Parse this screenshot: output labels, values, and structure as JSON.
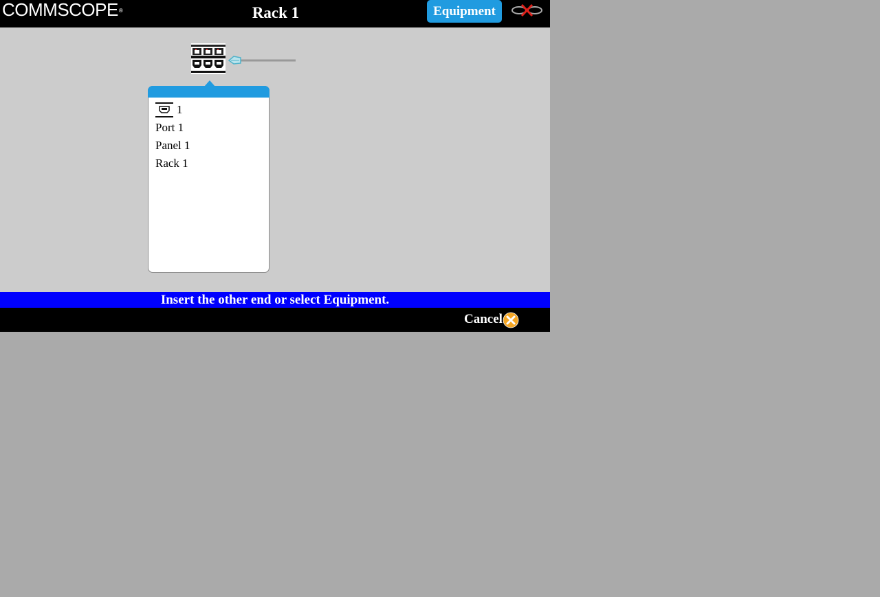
{
  "header": {
    "logo_text": "COMMSCOPE",
    "logo_mark": "®",
    "title": "Rack 1",
    "equipment_label": "Equipment",
    "disconnect_icon": "cable-disconnect-icon"
  },
  "canvas": {
    "panel_icon": "patch-panel-icon",
    "cable_icon": "patch-cord-icon"
  },
  "popup": {
    "port_icon": "rj45-port-icon",
    "port_number": "1",
    "lines": [
      "Port 1",
      "Panel 1",
      "Rack 1"
    ]
  },
  "status": {
    "message": "Insert the other end or select Equipment."
  },
  "footer": {
    "cancel_label": "Cancel",
    "cancel_icon": "cancel-x-icon"
  },
  "colors": {
    "accent_blue": "#209be0",
    "status_blue": "#0000ff",
    "cancel_orange": "#f5a623"
  }
}
